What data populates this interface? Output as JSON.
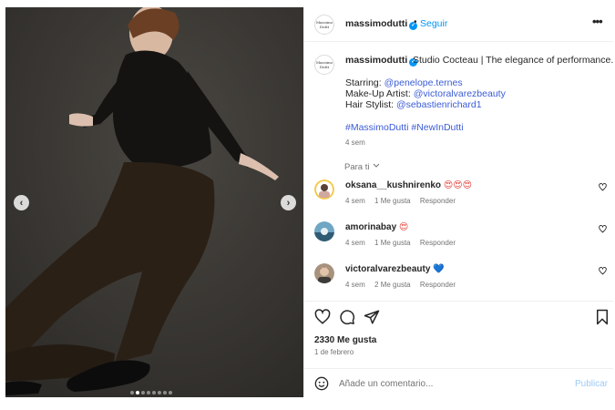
{
  "post": {
    "username": "massimodutti",
    "brand_logo_text": "Massimo Dutti",
    "separator": "•",
    "follow_label": "Seguir",
    "more_label": "•••",
    "caption": {
      "text": "Studio Cocteau | The elegance of performance.",
      "starring_label": "Starring:",
      "starring_handle": "@penelope.ternes",
      "makeup_label": "Make-Up Artist:",
      "makeup_handle": "@victoralvarezbeauty",
      "hair_label": "Hair Stylist:",
      "hair_handle": "@sebastienrichard1",
      "hashtags": "#MassimoDutti #NewInDutti",
      "time": "4 sem"
    },
    "filter_label": "Para ti",
    "filter_icon": "chevron-down-icon",
    "likes": "2330 Me gusta",
    "date": "1 de febrero",
    "carousel": {
      "total_slides": 8,
      "active_slide": 2
    }
  },
  "comments": [
    {
      "user": "oksana__kushnirenko",
      "text": "😍😍😍",
      "time": "4 sem",
      "likes": "1 Me gusta",
      "reply": "Responder"
    },
    {
      "user": "amorinabay",
      "text": "😍",
      "time": "4 sem",
      "likes": "1 Me gusta",
      "reply": "Responder"
    },
    {
      "user": "victoralvarezbeauty",
      "text": "💙",
      "time": "4 sem",
      "likes": "2 Me gusta",
      "reply": "Responder"
    }
  ],
  "composer": {
    "placeholder": "Añade un comentario...",
    "publish_label": "Publicar"
  },
  "icons": [
    "chevron-left-icon",
    "chevron-right-icon",
    "heart-icon",
    "comment-icon",
    "share-icon",
    "bookmark-icon",
    "emoji-icon",
    "verified-icon"
  ],
  "colors": {
    "accent": "#0095f6",
    "link": "#3b5cd6",
    "muted": "#737373",
    "text": "#262626"
  }
}
